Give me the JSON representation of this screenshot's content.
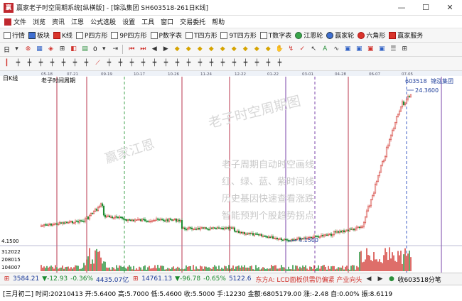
{
  "window": {
    "title": "赢家老子时空周期系统[纵横版] - [锦泓集团  SH603518-261日K线]",
    "icon_text": "赢",
    "buttons": [
      "—",
      "☐",
      "✕"
    ]
  },
  "menu": [
    "文件",
    "浏览",
    "资讯",
    "江恩",
    "公式选股",
    "设置",
    "工具",
    "窗口",
    "交易委托",
    "帮助"
  ],
  "toolbar1": [
    {
      "label": "行情",
      "icon": "grid-icon"
    },
    {
      "label": "板块",
      "icon": "plate-icon"
    },
    {
      "label": "K线",
      "icon": "kline-icon"
    },
    {
      "label": "P四方形",
      "icon": "square-icon"
    },
    {
      "label": "9P四方形",
      "icon": "square-icon"
    },
    {
      "label": "P数字表",
      "icon": "table-icon"
    },
    {
      "label": "T四方形",
      "icon": "square-icon"
    },
    {
      "label": "9T四方形",
      "icon": "square-icon"
    },
    {
      "label": "T数字表",
      "icon": "table-icon"
    },
    {
      "label": "江恩轮",
      "icon": "wheel-icon"
    },
    {
      "label": "赢家轮",
      "icon": "wheel-icon"
    },
    {
      "label": "六角形",
      "icon": "hexagon-icon"
    },
    {
      "label": "赢家服务",
      "icon": "service-icon"
    }
  ],
  "toolbar2_left": [
    "日",
    "0"
  ],
  "chart": {
    "panel_title": "日K线",
    "overlay_title": "老子时间周期",
    "stock_code": "603518",
    "stock_name": "锦泓集团",
    "high_price_label": "24.3600",
    "low_price_label": "4.1500",
    "left_price_label": "4.1500",
    "volume_axis": [
      "312022",
      "208015",
      "104007"
    ],
    "date_ticks": [
      "05-18",
      "07-21",
      "09-19",
      "10-17",
      "10-26",
      "11-24",
      "12-22",
      "01-22",
      "03-01",
      "04-28",
      "06-07",
      "07-05"
    ],
    "watermark_1": "赢家江恩",
    "watermark_2": "老子时空周期图",
    "promo_lines": [
      "老子周期自动时空画线",
      "红、绿、蓝、紫时间线",
      "历史基因快速查看涨跌",
      "智能预判个股趋势拐点"
    ]
  },
  "ticker": {
    "index1_value": "3584.21",
    "index1_change": "▼-12.93",
    "index1_pct": "-0.36%",
    "index1_amount": "4435.07亿",
    "index2_value": "14761.13",
    "index2_change": "▼-96.78",
    "index2_pct": "-0.65%",
    "index2_amount": "5122.6",
    "news": "东方A: LCD面板供需仍偏紧 产业向头",
    "right_text": "收603518分笔"
  },
  "status": {
    "text": "[三月初二] 时间:20210413 开:5.6400 高:5.7000 低:5.4600 收:5.5000 手:12230 金额:6805179.00 涨:-2.48 自:0.00% 振:8.6119"
  },
  "colors": {
    "up": "#d0302a",
    "down": "#1a8a2e",
    "red_line": "#b3213a",
    "green_line": "#2e9a3c",
    "purple_line": "#6b2fa0",
    "blue_line": "#2a4ec0"
  }
}
